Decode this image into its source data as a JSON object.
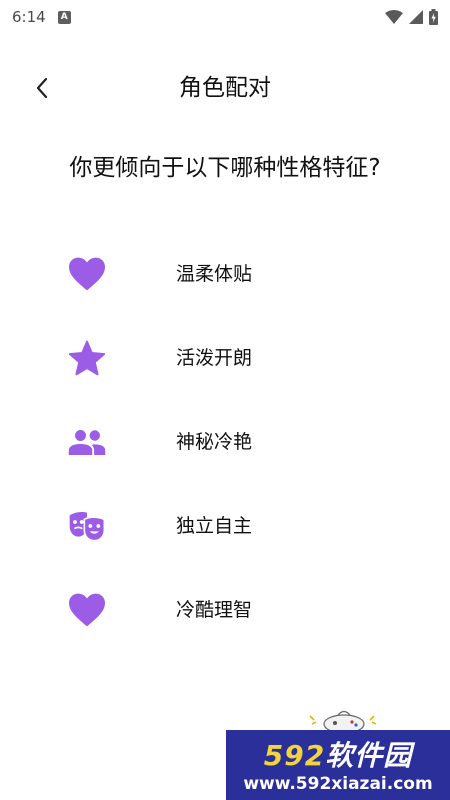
{
  "status_bar": {
    "time": "6:14",
    "notification_letter": "A"
  },
  "header": {
    "title": "角色配对"
  },
  "question": "你更倾向于以下哪种性格特征?",
  "options": [
    {
      "label": "温柔体贴",
      "icon": "heart-icon"
    },
    {
      "label": "活泼开朗",
      "icon": "star-icon"
    },
    {
      "label": "神秘冷艳",
      "icon": "people-icon"
    },
    {
      "label": "独立自主",
      "icon": "theater-masks-icon"
    },
    {
      "label": "冷酷理智",
      "icon": "heart-icon"
    }
  ],
  "accent_color": "#9b5de5",
  "watermark": {
    "number": "592",
    "text": "软件园",
    "url": "www.592xiazai.com"
  }
}
